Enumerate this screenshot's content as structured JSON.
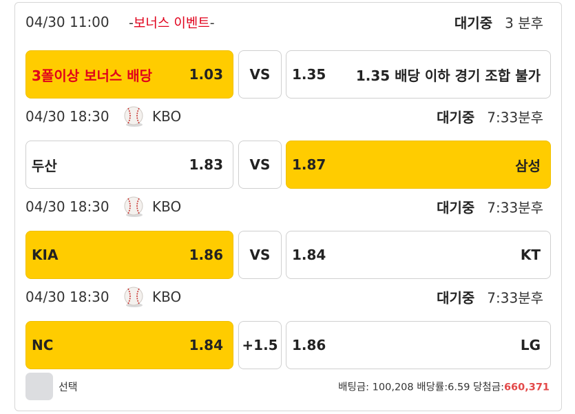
{
  "games": [
    {
      "datetime": "04/30 11:00",
      "event_prefix": "-",
      "event_name": "보너스 이벤트",
      "event_suffix": "-",
      "status": "대기중",
      "time_left": "3 분후",
      "home": {
        "name": "3폴이상 보너스 배당",
        "odds": "1.03",
        "selected": true
      },
      "middle": "VS",
      "away": {
        "odds": "1.35",
        "name": "1.35 배당 이하 경기 조합 불가",
        "selected": false
      }
    },
    {
      "datetime": "04/30 18:30",
      "league_icon": "baseball-icon",
      "league": "KBO",
      "status": "대기중",
      "time_left": "7:33분후",
      "home": {
        "name": "두산",
        "odds": "1.83",
        "selected": false
      },
      "middle": "VS",
      "away": {
        "odds": "1.87",
        "name": "삼성",
        "selected": true
      }
    },
    {
      "datetime": "04/30 18:30",
      "league_icon": "baseball-icon",
      "league": "KBO",
      "status": "대기중",
      "time_left": "7:33분후",
      "home": {
        "name": "KIA",
        "odds": "1.86",
        "selected": true
      },
      "middle": "VS",
      "away": {
        "odds": "1.84",
        "name": "KT",
        "selected": false
      }
    },
    {
      "datetime": "04/30 18:30",
      "league_icon": "baseball-icon",
      "league": "KBO",
      "status": "대기중",
      "time_left": "7:33분후",
      "home": {
        "name": "NC",
        "odds": "1.84",
        "selected": true
      },
      "middle": "+1.5",
      "away": {
        "odds": "1.86",
        "name": "LG",
        "selected": false
      }
    }
  ],
  "footer": {
    "select_label": "선택",
    "bet_label": "배팅금:",
    "bet_amount": "100,208",
    "rate_label": "배당률:",
    "rate": "6.59",
    "win_label": "당첨금:",
    "win_amount": "660,371"
  },
  "colors": {
    "selected_bg": "#ffcc00",
    "event_red": "#e0001b",
    "win_amount": "#e34949",
    "checkbox": "#dcdde0"
  }
}
